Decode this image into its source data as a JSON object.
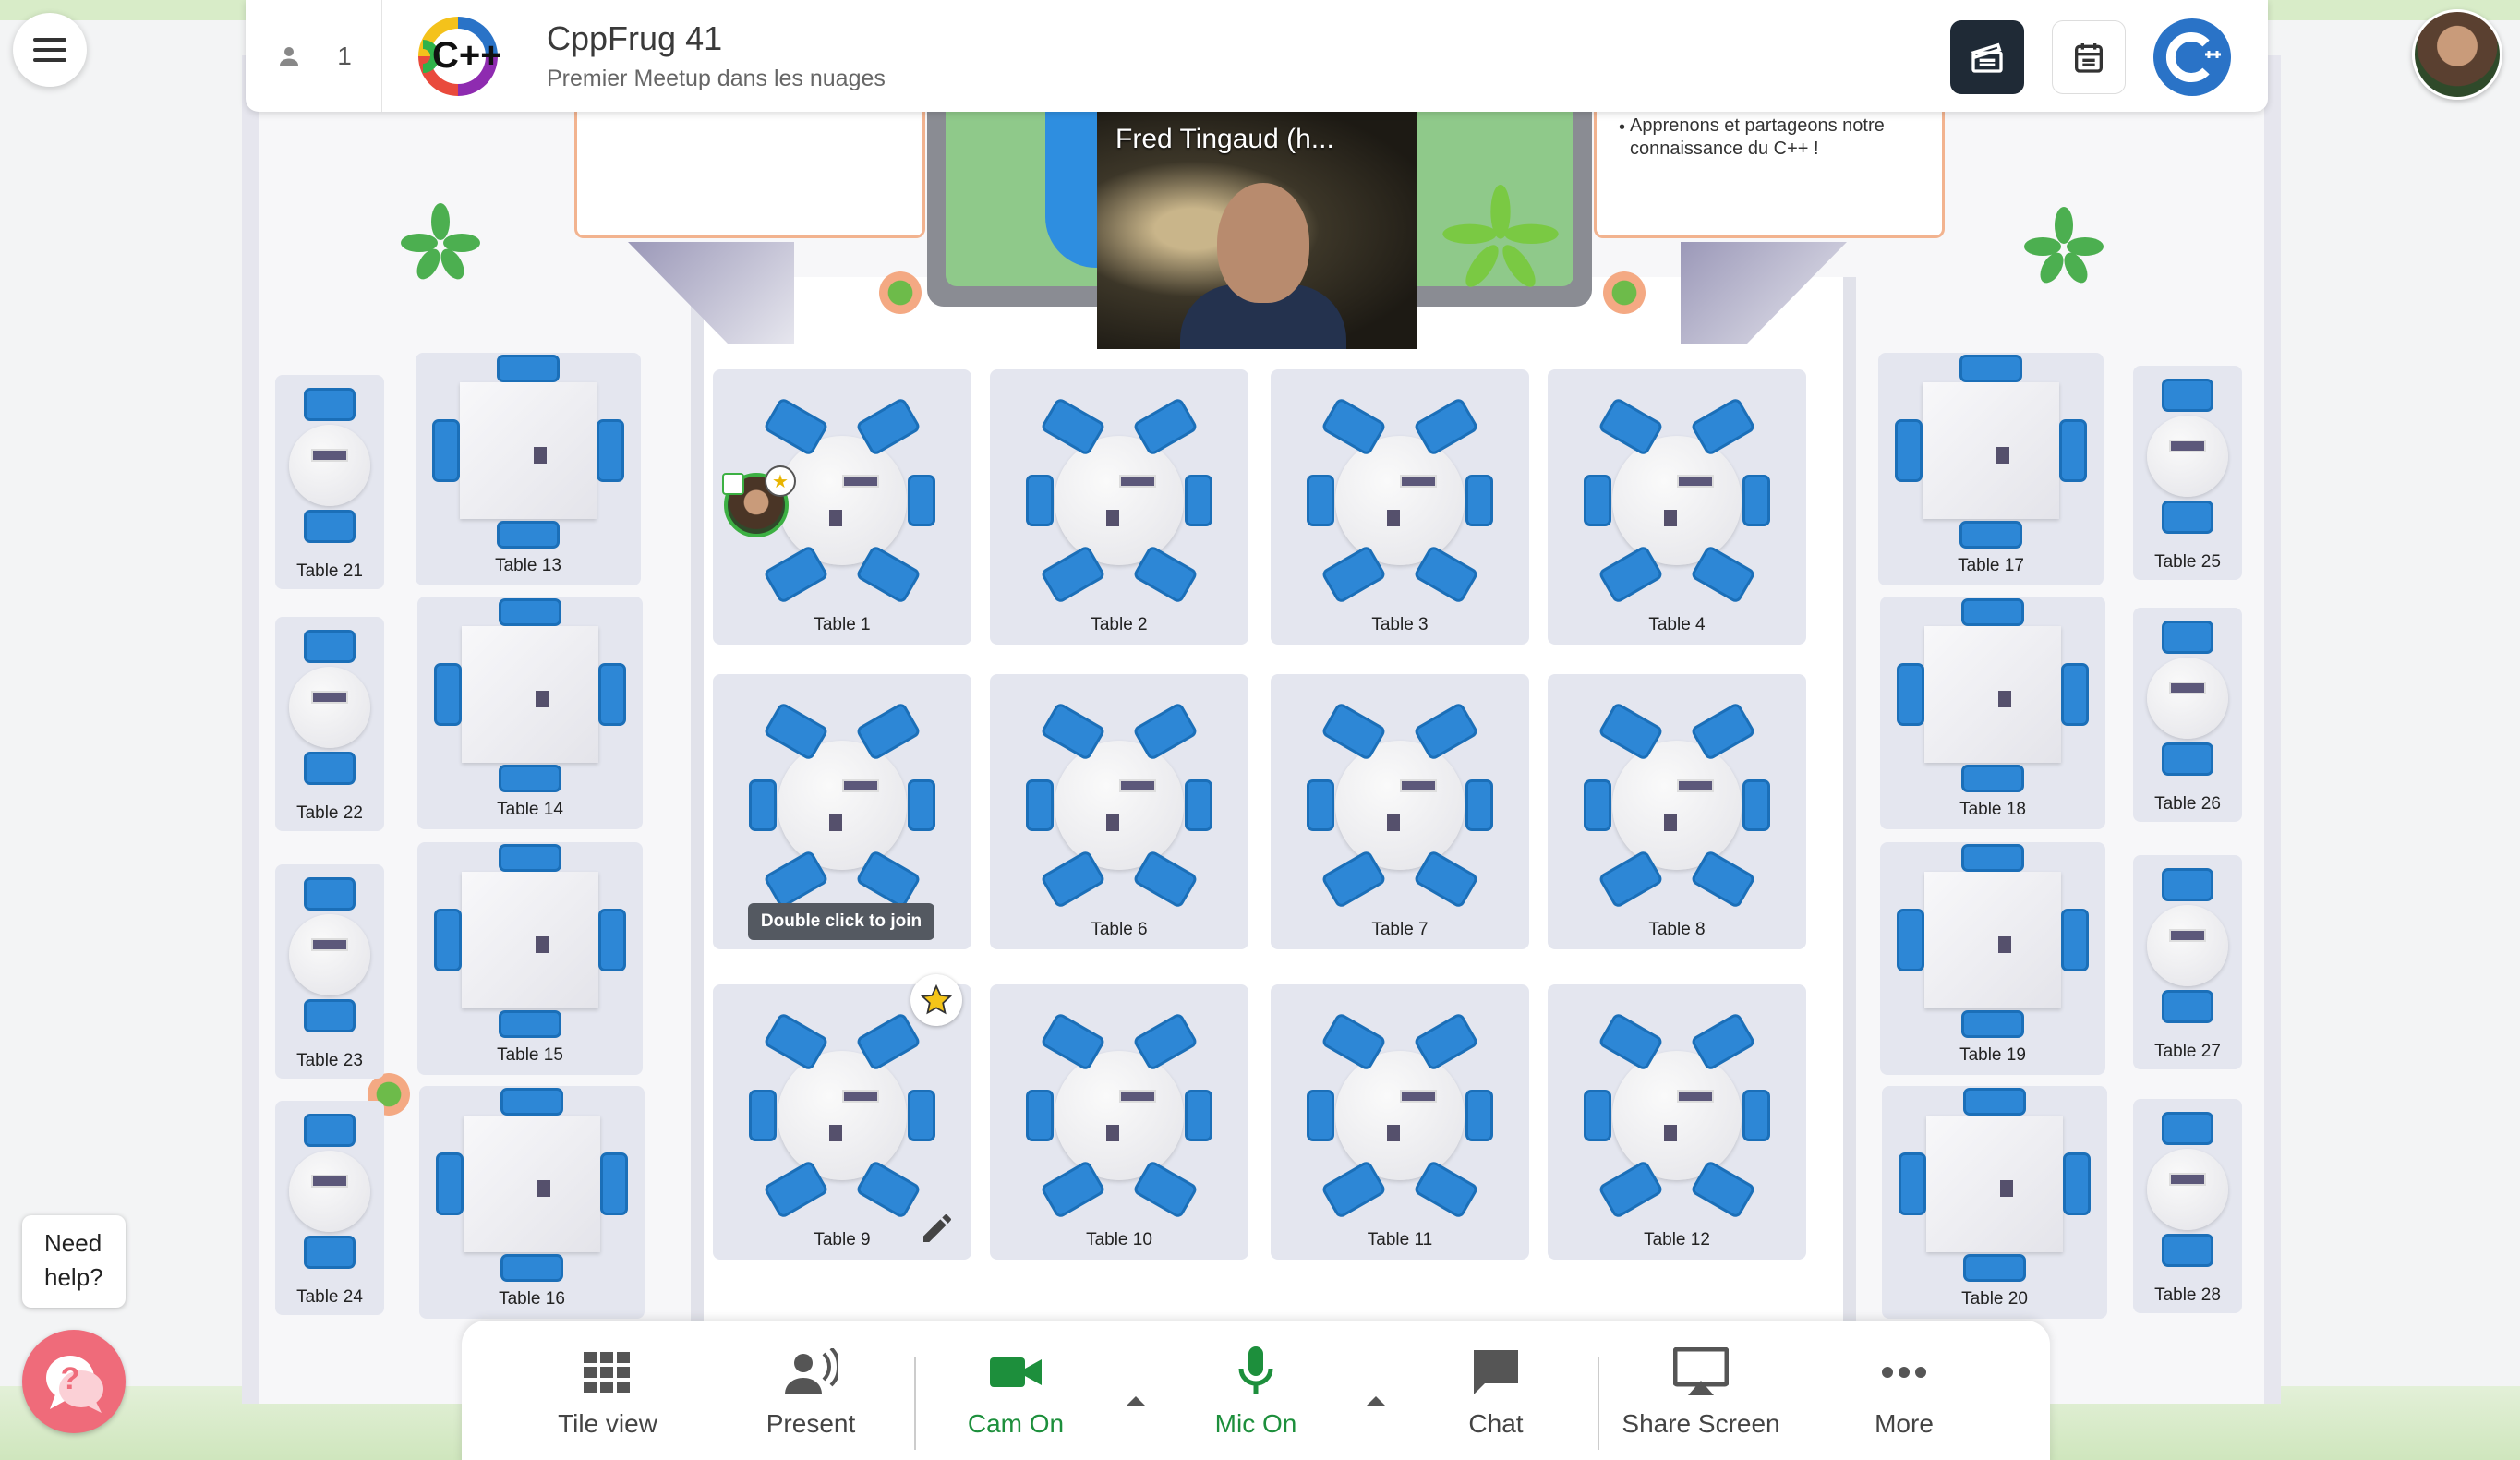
{
  "header": {
    "participant_count": "1",
    "event_title": "CppFrug 41",
    "event_subtitle": "Premier Meetup dans les nuages",
    "logo_text": "C++"
  },
  "board_right": {
    "bullet": "•",
    "text": "Apprenons et partageons notre connaissance du C++ !"
  },
  "video": {
    "name": "Fred Tingaud (h..."
  },
  "tooltip": "Double click to join",
  "tables": {
    "t1": "Table 1",
    "t2": "Table 2",
    "t3": "Table 3",
    "t4": "Table 4",
    "t6": "Table 6",
    "t7": "Table 7",
    "t8": "Table 8",
    "t9": "Table 9",
    "t10": "Table 10",
    "t11": "Table 11",
    "t12": "Table 12",
    "t13": "Table 13",
    "t14": "Table 14",
    "t15": "Table 15",
    "t16": "Table 16",
    "t17": "Table 17",
    "t18": "Table 18",
    "t19": "Table 19",
    "t20": "Table 20",
    "t21": "Table 21",
    "t22": "Table 22",
    "t23": "Table 23",
    "t24": "Table 24",
    "t25": "Table 25",
    "t26": "Table 26",
    "t27": "Table 27",
    "t28": "Table 28"
  },
  "toolbar": {
    "tile_view": "Tile view",
    "present": "Present",
    "cam": "Cam On",
    "mic": "Mic On",
    "chat": "Chat",
    "share": "Share Screen",
    "more": "More"
  },
  "help": {
    "label": "Need help?",
    "icon": "?"
  },
  "colors": {
    "accent_green": "#1d8f3c",
    "chair_blue": "#2d87d6",
    "dark_button": "#1f2a36"
  }
}
